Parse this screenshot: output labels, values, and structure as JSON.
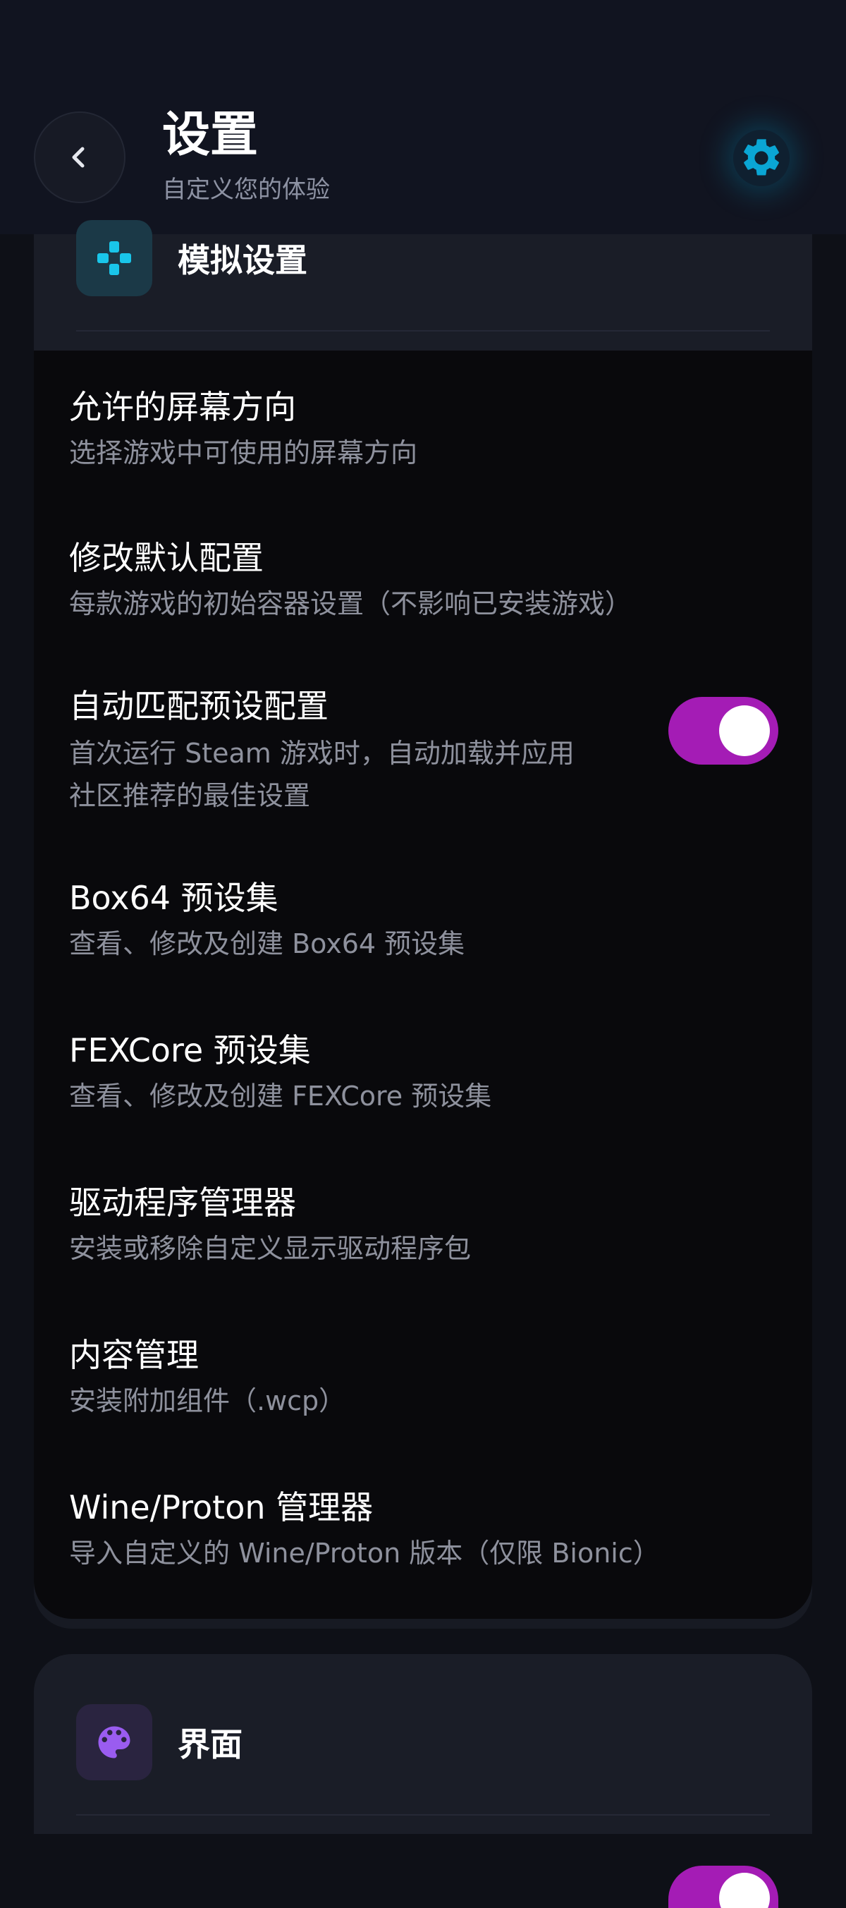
{
  "header": {
    "title": "设置",
    "subtitle": "自定义您的体验",
    "back_icon": "chevron-left-icon",
    "settings_icon": "gear-icon",
    "accent": "#0aa6d4"
  },
  "sections": {
    "emulation": {
      "title": "模拟设置",
      "icon": "gamepad-icon",
      "icon_color": "#19c6ea",
      "items": [
        {
          "title": "允许的屏幕方向",
          "desc": [
            "选择游戏中可使用的屏幕方向"
          ]
        },
        {
          "title": "修改默认配置",
          "desc": [
            "每款游戏的初始容器设置（不影响已安装游戏）"
          ]
        },
        {
          "title": "自动匹配预设配置",
          "desc": [
            "首次运行 Steam 游戏时，自动加载并应用",
            "社区推荐的最佳设置"
          ],
          "toggle_on": true
        },
        {
          "title": "Box64 预设集",
          "desc": [
            "查看、修改及创建 Box64 预设集"
          ]
        },
        {
          "title": "FEXCore 预设集",
          "desc": [
            "查看、修改及创建 FEXCore 预设集"
          ]
        },
        {
          "title": "驱动程序管理器",
          "desc": [
            "安装或移除自定义显示驱动程序包"
          ]
        },
        {
          "title": "内容管理",
          "desc": [
            "安装附加组件（.wcp）"
          ]
        },
        {
          "title": "Wine/Proton 管理器",
          "desc": [
            "导入自定义的 Wine/Proton 版本（仅限 Bionic）"
          ]
        }
      ]
    },
    "interface": {
      "title": "界面",
      "icon": "palette-icon",
      "icon_color": "#9a5cf0"
    }
  },
  "colors": {
    "toggle_on": "#a41cb5"
  }
}
